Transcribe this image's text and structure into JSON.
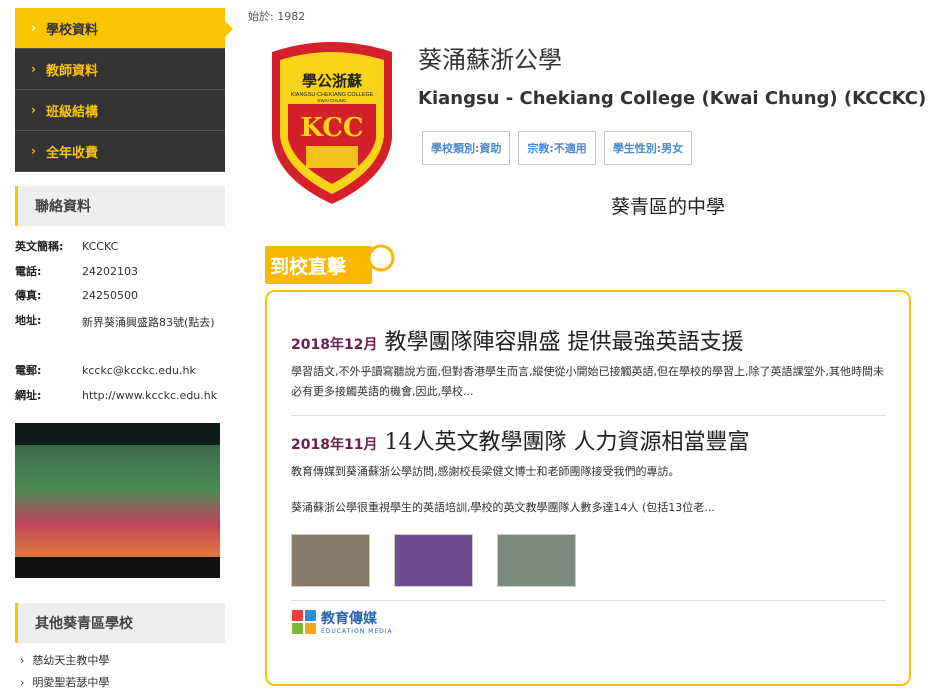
{
  "sidebar": {
    "nav": [
      {
        "label": "學校資料",
        "active": true
      },
      {
        "label": "教師資料",
        "active": false
      },
      {
        "label": "班級結構",
        "active": false
      },
      {
        "label": "全年收費",
        "active": false
      }
    ],
    "contact_heading": "聯絡資料",
    "contact": [
      {
        "label": "英文簡稱:",
        "value": "KCCKC"
      },
      {
        "label": "電話:",
        "value": "24202103"
      },
      {
        "label": "傳真:",
        "value": "24250500"
      },
      {
        "label": "地址:",
        "value": "新界葵涌興盛路83號(點去)"
      },
      {
        "label": "電郵:",
        "value": "kcckc@kcckc.edu.hk"
      },
      {
        "label": "網址:",
        "value": "http://www.kcckc.edu.hk"
      }
    ],
    "other_heading": "其他葵青區學校",
    "other_schools": [
      "慈幼天主教中學",
      "明愛聖若瑟中學"
    ]
  },
  "main": {
    "since": "始於: 1982",
    "school_name_zh": "葵涌蘇浙公學",
    "school_name_en": "Kiangsu - Chekiang College (Kwai Chung) (KCCKC)",
    "tags": [
      "學校類別:資助",
      "宗教:不適用",
      "學生性別:男女"
    ],
    "district": "葵青區的中學",
    "visit_badge": "到校直擊",
    "logo": {
      "top_text": "學公浙蘇",
      "mid_text": "KIANGSU-CHEKIANG COLLEGE",
      "sub_text": "KWAI CHUNG",
      "letters": "KCC"
    },
    "articles": [
      {
        "date": "2018年12月",
        "title": "教學團隊陣容鼎盛 提供最強英語支援",
        "body": "學習語文,不外乎讀寫聽說方面,但對香港學生而言,縱使從小開始已接觸英語,但在學校的學習上,除了英語課堂外,其他時間未必有更多接觸英語的機會,因此,學校..."
      },
      {
        "date": "2018年11月",
        "title": "14人英文教學團隊 人力資源相當豐富",
        "body1": "教育傳媒到葵涌蘇浙公學訪問,感謝校長梁健文博士和老師團隊接受我們的專訪。",
        "body2": "葵涌蘇浙公學很重視學生的英語培訓,學校的英文教學團隊人數多達14人 (包括13位老..."
      }
    ],
    "media_name_zh": "教育傳媒",
    "media_name_en": "EDUCATION MEDIA"
  }
}
